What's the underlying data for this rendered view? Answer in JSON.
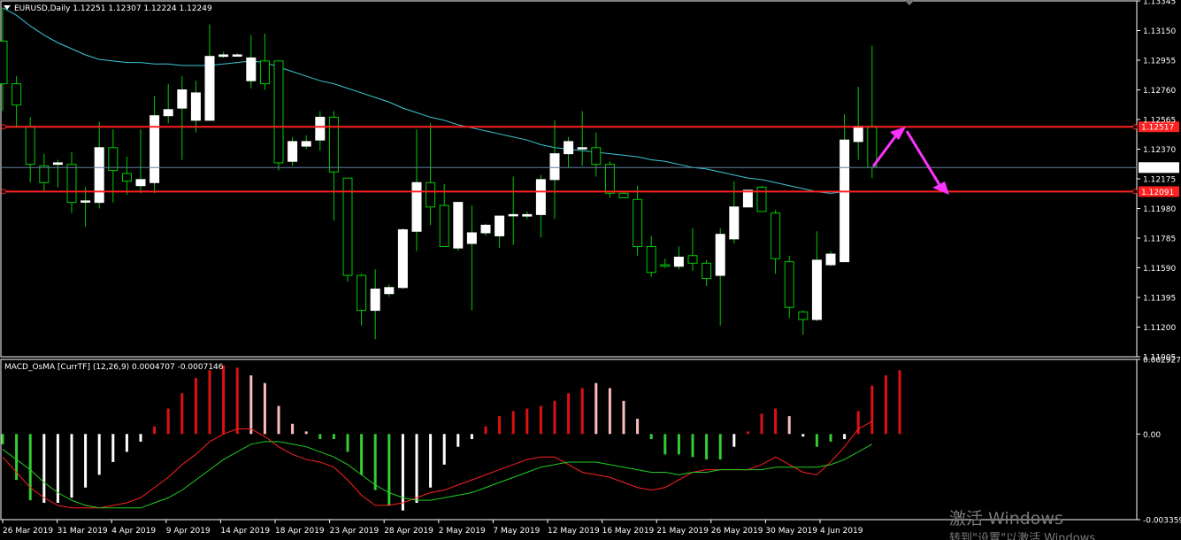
{
  "header": {
    "symbol_line": "EURUSD,Daily  1.12251 1.12307 1.12224 1.12249",
    "indicator_line": "MACD_OsMA [CurrTF] (12,26,9) 0.0004707 -0.0007146"
  },
  "watermark": {
    "line1": "激活 Windows",
    "line2": "转到\"设置\"以激活 Windows"
  },
  "colors": {
    "background": "#000000",
    "grid_frame": "#ffffff",
    "bull_body": "#ffffff",
    "wick": "#00cc00",
    "ma_line": "#3ec7d6",
    "resistance": "#ff2020",
    "arrow": "#ff33ff",
    "hist_green": "#33cc33",
    "hist_white": "#ffffff",
    "hist_red": "#dd1111",
    "hist_pink": "#ffbbbb",
    "macd_line": "#ff2020",
    "signal_line": "#22cc22"
  },
  "chart_data": [
    {
      "type": "candlestick",
      "title": "EURUSD,Daily",
      "ylim": [
        1.11005,
        1.13345
      ],
      "y_ticks": [
        "1.13345",
        "1.13150",
        "1.12955",
        "1.12760",
        "1.12565",
        "1.12370",
        "1.12175",
        "1.11980",
        "1.11785",
        "1.11590",
        "1.11395",
        "1.11200",
        "1.11005"
      ],
      "x_ticks": [
        "26 Mar 2019",
        "31 Mar 2019",
        "4 Apr 2019",
        "9 Apr 2019",
        "14 Apr 2019",
        "18 Apr 2019",
        "23 Apr 2019",
        "28 Apr 2019",
        "2 May 2019",
        "7 May 2019",
        "12 May 2019",
        "16 May 2019",
        "21 May 2019",
        "26 May 2019",
        "30 May 2019",
        "4 Jun 2019"
      ],
      "candles": [
        {
          "o": 1.1308,
          "h": 1.133,
          "l": 1.1262,
          "c": 1.128
        },
        {
          "o": 1.128,
          "h": 1.1285,
          "l": 1.1251,
          "c": 1.1266
        },
        {
          "o": 1.1252,
          "h": 1.1258,
          "l": 1.1215,
          "c": 1.1227
        },
        {
          "o": 1.1226,
          "h": 1.1234,
          "l": 1.1209,
          "c": 1.1215
        },
        {
          "o": 1.1227,
          "h": 1.123,
          "l": 1.1212,
          "c": 1.1228
        },
        {
          "o": 1.1227,
          "h": 1.1235,
          "l": 1.1195,
          "c": 1.1202
        },
        {
          "o": 1.1203,
          "h": 1.1212,
          "l": 1.1186,
          "c": 1.1203
        },
        {
          "o": 1.1202,
          "h": 1.1255,
          "l": 1.1198,
          "c": 1.1238
        },
        {
          "o": 1.1238,
          "h": 1.125,
          "l": 1.1202,
          "c": 1.1223
        },
        {
          "o": 1.1221,
          "h": 1.1232,
          "l": 1.1207,
          "c": 1.1216
        },
        {
          "o": 1.1213,
          "h": 1.125,
          "l": 1.1208,
          "c": 1.1217
        },
        {
          "o": 1.1215,
          "h": 1.1272,
          "l": 1.1208,
          "c": 1.1259
        },
        {
          "o": 1.1259,
          "h": 1.128,
          "l": 1.1254,
          "c": 1.1263
        },
        {
          "o": 1.1264,
          "h": 1.1285,
          "l": 1.123,
          "c": 1.1276
        },
        {
          "o": 1.1256,
          "h": 1.1282,
          "l": 1.1248,
          "c": 1.1274
        },
        {
          "o": 1.1256,
          "h": 1.1319,
          "l": 1.1257,
          "c": 1.1298
        },
        {
          "o": 1.1298,
          "h": 1.1301,
          "l": 1.1297,
          "c": 1.1299
        },
        {
          "o": 1.1299,
          "h": 1.13,
          "l": 1.1298,
          "c": 1.1299
        },
        {
          "o": 1.1282,
          "h": 1.1312,
          "l": 1.1277,
          "c": 1.1297
        },
        {
          "o": 1.1295,
          "h": 1.1313,
          "l": 1.1276,
          "c": 1.128
        },
        {
          "o": 1.1295,
          "h": 1.1295,
          "l": 1.1223,
          "c": 1.1228
        },
        {
          "o": 1.1229,
          "h": 1.1245,
          "l": 1.1226,
          "c": 1.1242
        },
        {
          "o": 1.1239,
          "h": 1.1246,
          "l": 1.1237,
          "c": 1.1242
        },
        {
          "o": 1.1243,
          "h": 1.1262,
          "l": 1.1236,
          "c": 1.1258
        },
        {
          "o": 1.1258,
          "h": 1.1262,
          "l": 1.119,
          "c": 1.1222
        },
        {
          "o": 1.1218,
          "h": 1.1218,
          "l": 1.115,
          "c": 1.1154
        },
        {
          "o": 1.1154,
          "h": 1.1155,
          "l": 1.1121,
          "c": 1.1131
        },
        {
          "o": 1.1131,
          "h": 1.1158,
          "l": 1.1112,
          "c": 1.1145
        },
        {
          "o": 1.1142,
          "h": 1.1148,
          "l": 1.114,
          "c": 1.1146
        },
        {
          "o": 1.1146,
          "h": 1.1185,
          "l": 1.1145,
          "c": 1.1184
        },
        {
          "o": 1.1183,
          "h": 1.125,
          "l": 1.117,
          "c": 1.1215
        },
        {
          "o": 1.1215,
          "h": 1.1254,
          "l": 1.1187,
          "c": 1.1199
        },
        {
          "o": 1.12,
          "h": 1.1214,
          "l": 1.1173,
          "c": 1.1173
        },
        {
          "o": 1.1172,
          "h": 1.1202,
          "l": 1.117,
          "c": 1.1202
        },
        {
          "o": 1.1175,
          "h": 1.12,
          "l": 1.1131,
          "c": 1.1182
        },
        {
          "o": 1.1182,
          "h": 1.1188,
          "l": 1.118,
          "c": 1.1187
        },
        {
          "o": 1.118,
          "h": 1.1191,
          "l": 1.1172,
          "c": 1.1193
        },
        {
          "o": 1.1194,
          "h": 1.1219,
          "l": 1.1174,
          "c": 1.1194
        },
        {
          "o": 1.1193,
          "h": 1.1196,
          "l": 1.1191,
          "c": 1.1194
        },
        {
          "o": 1.1194,
          "h": 1.122,
          "l": 1.1179,
          "c": 1.1217
        },
        {
          "o": 1.1217,
          "h": 1.1256,
          "l": 1.1191,
          "c": 1.1234
        },
        {
          "o": 1.1234,
          "h": 1.1245,
          "l": 1.1225,
          "c": 1.1242
        },
        {
          "o": 1.1238,
          "h": 1.1262,
          "l": 1.1226,
          "c": 1.1238
        },
        {
          "o": 1.1238,
          "h": 1.1248,
          "l": 1.1219,
          "c": 1.1227
        },
        {
          "o": 1.1227,
          "h": 1.1229,
          "l": 1.1205,
          "c": 1.1208
        },
        {
          "o": 1.1208,
          "h": 1.1209,
          "l": 1.1205,
          "c": 1.1205
        },
        {
          "o": 1.1204,
          "h": 1.1213,
          "l": 1.1167,
          "c": 1.1173
        },
        {
          "o": 1.1173,
          "h": 1.118,
          "l": 1.1153,
          "c": 1.1156
        },
        {
          "o": 1.1161,
          "h": 1.1165,
          "l": 1.1159,
          "c": 1.116
        },
        {
          "o": 1.116,
          "h": 1.1173,
          "l": 1.1158,
          "c": 1.1166
        },
        {
          "o": 1.1167,
          "h": 1.1185,
          "l": 1.1157,
          "c": 1.1162
        },
        {
          "o": 1.1162,
          "h": 1.1164,
          "l": 1.1147,
          "c": 1.1152
        },
        {
          "o": 1.1154,
          "h": 1.1185,
          "l": 1.1121,
          "c": 1.1181
        },
        {
          "o": 1.1178,
          "h": 1.1216,
          "l": 1.1175,
          "c": 1.1199
        },
        {
          "o": 1.1199,
          "h": 1.121,
          "l": 1.1209,
          "c": 1.121
        },
        {
          "o": 1.1212,
          "h": 1.1213,
          "l": 1.1197,
          "c": 1.1196
        },
        {
          "o": 1.1195,
          "h": 1.1197,
          "l": 1.1155,
          "c": 1.1165
        },
        {
          "o": 1.1163,
          "h": 1.1167,
          "l": 1.1126,
          "c": 1.1133
        },
        {
          "o": 1.113,
          "h": 1.1131,
          "l": 1.1115,
          "c": 1.1125
        },
        {
          "o": 1.1125,
          "h": 1.1183,
          "l": 1.1124,
          "c": 1.1164
        },
        {
          "o": 1.1161,
          "h": 1.117,
          "l": 1.116,
          "c": 1.1168
        },
        {
          "o": 1.1163,
          "h": 1.126,
          "l": 1.1164,
          "c": 1.1243
        },
        {
          "o": 1.1242,
          "h": 1.1278,
          "l": 1.123,
          "c": 1.1252
        },
        {
          "o": 1.1252,
          "h": 1.1305,
          "l": 1.1218,
          "c": 1.1225
        }
      ],
      "ma_series": [
        1.133,
        1.1325,
        1.1318,
        1.1312,
        1.1307,
        1.1303,
        1.1299,
        1.1296,
        1.1295,
        1.1294,
        1.1294,
        1.1293,
        1.1293,
        1.1292,
        1.1292,
        1.1292,
        1.1293,
        1.1294,
        1.1295,
        1.1294,
        1.1291,
        1.1288,
        1.1285,
        1.1282,
        1.128,
        1.1277,
        1.1274,
        1.1271,
        1.1268,
        1.1264,
        1.1261,
        1.1258,
        1.1256,
        1.1253,
        1.1251,
        1.1249,
        1.1247,
        1.1245,
        1.1243,
        1.124,
        1.1238,
        1.1237,
        1.1236,
        1.1235,
        1.1234,
        1.1233,
        1.1232,
        1.123,
        1.1229,
        1.1227,
        1.1225,
        1.1224,
        1.1222,
        1.122,
        1.1218,
        1.1217,
        1.1215,
        1.1213,
        1.1211,
        1.1209,
        1.1208,
        1.1209,
        1.1209,
        1.1209
      ],
      "horizontal_lines": [
        {
          "name": "upper-resistance",
          "value": 1.12517,
          "label": "1.12517"
        },
        {
          "name": "lower-support",
          "value": 1.12091,
          "label": "1.12091"
        },
        {
          "name": "current-price",
          "value": 1.12249,
          "label": "1.12249"
        }
      ],
      "annotation": "arrow up to 1.12517 then down to 1.12091"
    },
    {
      "type": "bar",
      "title": "MACD_OsMA [CurrTF] (12,26,9)",
      "ylim": [
        -0.003359,
        0.002927
      ],
      "y_ticks": [
        "0.002927",
        "0.00",
        "-0.003359"
      ],
      "histogram": [
        {
          "v": -0.0004,
          "c": "green"
        },
        {
          "v": -0.0018,
          "c": "green"
        },
        {
          "v": -0.0026,
          "c": "green"
        },
        {
          "v": -0.0027,
          "c": "white"
        },
        {
          "v": -0.0027,
          "c": "white"
        },
        {
          "v": -0.0025,
          "c": "white"
        },
        {
          "v": -0.0021,
          "c": "white"
        },
        {
          "v": -0.0016,
          "c": "white"
        },
        {
          "v": -0.0011,
          "c": "white"
        },
        {
          "v": -0.0007,
          "c": "white"
        },
        {
          "v": -0.0003,
          "c": "white"
        },
        {
          "v": 0.0003,
          "c": "red"
        },
        {
          "v": 0.001,
          "c": "red"
        },
        {
          "v": 0.0016,
          "c": "red"
        },
        {
          "v": 0.0022,
          "c": "red"
        },
        {
          "v": 0.0025,
          "c": "red"
        },
        {
          "v": 0.0027,
          "c": "red"
        },
        {
          "v": 0.0026,
          "c": "red"
        },
        {
          "v": 0.0023,
          "c": "pink"
        },
        {
          "v": 0.002,
          "c": "pink"
        },
        {
          "v": 0.0011,
          "c": "pink"
        },
        {
          "v": 0.0004,
          "c": "pink"
        },
        {
          "v": 0.0001,
          "c": "pink"
        },
        {
          "v": -0.0002,
          "c": "green"
        },
        {
          "v": -0.0002,
          "c": "green"
        },
        {
          "v": -0.0007,
          "c": "green"
        },
        {
          "v": -0.0016,
          "c": "green"
        },
        {
          "v": -0.0022,
          "c": "green"
        },
        {
          "v": -0.0028,
          "c": "green"
        },
        {
          "v": -0.003,
          "c": "white"
        },
        {
          "v": -0.0027,
          "c": "white"
        },
        {
          "v": -0.0021,
          "c": "white"
        },
        {
          "v": -0.0012,
          "c": "white"
        },
        {
          "v": -0.0005,
          "c": "white"
        },
        {
          "v": -0.0002,
          "c": "white"
        },
        {
          "v": 0.0003,
          "c": "red"
        },
        {
          "v": 0.0007,
          "c": "red"
        },
        {
          "v": 0.0009,
          "c": "red"
        },
        {
          "v": 0.001,
          "c": "red"
        },
        {
          "v": 0.0011,
          "c": "red"
        },
        {
          "v": 0.0013,
          "c": "red"
        },
        {
          "v": 0.0016,
          "c": "red"
        },
        {
          "v": 0.0018,
          "c": "red"
        },
        {
          "v": 0.002,
          "c": "pink"
        },
        {
          "v": 0.0018,
          "c": "pink"
        },
        {
          "v": 0.0013,
          "c": "pink"
        },
        {
          "v": 0.0006,
          "c": "pink"
        },
        {
          "v": -0.0002,
          "c": "green"
        },
        {
          "v": -0.0008,
          "c": "green"
        },
        {
          "v": -0.0008,
          "c": "green"
        },
        {
          "v": -0.0009,
          "c": "green"
        },
        {
          "v": -0.001,
          "c": "green"
        },
        {
          "v": -0.001,
          "c": "green"
        },
        {
          "v": -0.0005,
          "c": "white"
        },
        {
          "v": 0.0001,
          "c": "red"
        },
        {
          "v": 0.0008,
          "c": "red"
        },
        {
          "v": 0.001,
          "c": "red"
        },
        {
          "v": 0.0007,
          "c": "pink"
        },
        {
          "v": -0.0001,
          "c": "white"
        },
        {
          "v": -0.0005,
          "c": "green"
        },
        {
          "v": -0.0003,
          "c": "green"
        },
        {
          "v": -0.0002,
          "c": "white"
        },
        {
          "v": 0.0009,
          "c": "red"
        },
        {
          "v": 0.0019,
          "c": "red"
        },
        {
          "v": 0.0023,
          "c": "red"
        },
        {
          "v": 0.0025,
          "c": "red"
        }
      ],
      "macd_line": [
        -0.0009,
        -0.0015,
        -0.0021,
        -0.0025,
        -0.0028,
        -0.0029,
        -0.0029,
        -0.0029,
        -0.0028,
        -0.0027,
        -0.0025,
        -0.0021,
        -0.0017,
        -0.0012,
        -0.0008,
        -0.0003,
        0.0,
        0.0002,
        0.0002,
        -0.0001,
        -0.0005,
        -0.0008,
        -0.001,
        -0.0011,
        -0.0013,
        -0.0018,
        -0.0024,
        -0.0028,
        -0.0028,
        -0.0027,
        -0.0025,
        -0.0023,
        -0.0022,
        -0.002,
        -0.0018,
        -0.0016,
        -0.0014,
        -0.0012,
        -0.001,
        -0.0009,
        -0.0009,
        -0.0012,
        -0.0015,
        -0.0016,
        -0.0017,
        -0.0019,
        -0.0021,
        -0.0022,
        -0.0021,
        -0.0018,
        -0.0015,
        -0.0014,
        -0.0014,
        -0.0014,
        -0.0014,
        -0.0012,
        -0.0009,
        -0.0012,
        -0.0015,
        -0.0016,
        -0.0011,
        -0.0005,
        0.0002,
        0.0005
      ],
      "signal_line": [
        -0.0006,
        -0.001,
        -0.0014,
        -0.0019,
        -0.0023,
        -0.0026,
        -0.0028,
        -0.0029,
        -0.0029,
        -0.0029,
        -0.0029,
        -0.0027,
        -0.0025,
        -0.0022,
        -0.0018,
        -0.0014,
        -0.001,
        -0.0007,
        -0.0004,
        -0.0003,
        -0.0003,
        -0.0004,
        -0.0005,
        -0.0007,
        -0.0009,
        -0.0012,
        -0.0016,
        -0.002,
        -0.0023,
        -0.0025,
        -0.0026,
        -0.0026,
        -0.0025,
        -0.0024,
        -0.0023,
        -0.0021,
        -0.0019,
        -0.0017,
        -0.0015,
        -0.0013,
        -0.0012,
        -0.0011,
        -0.0011,
        -0.0011,
        -0.0012,
        -0.0013,
        -0.0014,
        -0.0015,
        -0.0015,
        -0.0016,
        -0.0015,
        -0.0015,
        -0.0014,
        -0.0014,
        -0.0014,
        -0.0014,
        -0.0013,
        -0.0013,
        -0.0013,
        -0.0013,
        -0.0012,
        -0.001,
        -0.0007,
        -0.0004
      ]
    }
  ]
}
